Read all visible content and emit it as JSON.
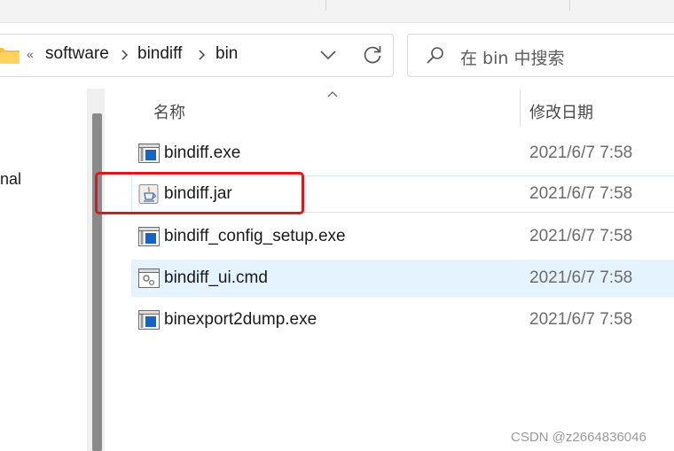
{
  "address": {
    "overflow_glyph": "«",
    "crumbs": [
      "software",
      "bindiff",
      "bin"
    ]
  },
  "search": {
    "placeholder": "在 bin 中搜索"
  },
  "nav": {
    "partial_text": "nal"
  },
  "columns": {
    "name": "名称",
    "date_modified": "修改日期"
  },
  "files": [
    {
      "name": "bindiff.exe",
      "date": "2021/6/7 7:58",
      "icon": "exe-icon"
    },
    {
      "name": "bindiff.jar",
      "date": "2021/6/7 7:58",
      "icon": "java-jar-icon"
    },
    {
      "name": "bindiff_config_setup.exe",
      "date": "2021/6/7 7:58",
      "icon": "exe-icon"
    },
    {
      "name": "bindiff_ui.cmd",
      "date": "2021/6/7 7:58",
      "icon": "cmd-script-icon"
    },
    {
      "name": "binexport2dump.exe",
      "date": "2021/6/7 7:58",
      "icon": "exe-icon"
    }
  ],
  "watermark": "CSDN @z2664836046",
  "colors": {
    "highlight": "#e0161b",
    "selection": "#e5f3ff",
    "scrollbar_thumb": "#8a8a8a"
  }
}
